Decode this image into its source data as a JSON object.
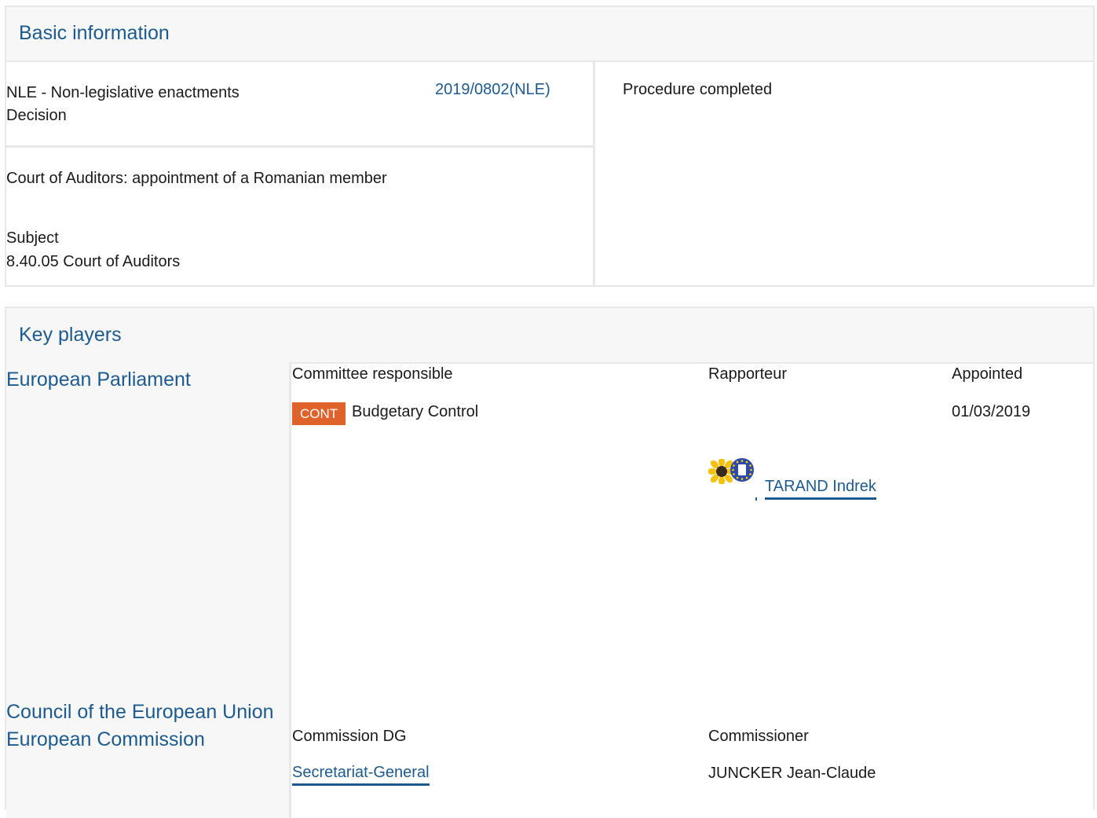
{
  "basic": {
    "title": "Basic information",
    "procedure_type": "NLE - Non-legislative enactments",
    "procedure_subtype": "Decision",
    "reference": "2019/0802(NLE)",
    "status": "Procedure completed",
    "procedure_title": "Court of Auditors: appointment of a Romanian member",
    "subject_label": "Subject",
    "subject_value": "8.40.05 Court of Auditors"
  },
  "key_players": {
    "title": "Key players",
    "ep": {
      "label": "European Parliament",
      "col_committee": "Committee responsible",
      "col_rapporteur": "Rapporteur",
      "col_appointed": "Appointed",
      "committee_code": "CONT",
      "committee_name": "Budgetary Control",
      "appointed_date": "01/03/2019",
      "rapporteur_name": "TARAND Indrek"
    },
    "council": {
      "label": "Council of the European Union"
    },
    "commission": {
      "label": "European Commission",
      "col_dg": "Commission DG",
      "col_commissioner": "Commissioner",
      "dg_name": "Secretariat-General",
      "commissioner_name": "JUNCKER Jean-Claude"
    }
  },
  "colors": {
    "link": "#1d5a8e",
    "badge": "#e0622b",
    "border": "#e8e8e8",
    "header_bg": "#f7f7f7"
  }
}
